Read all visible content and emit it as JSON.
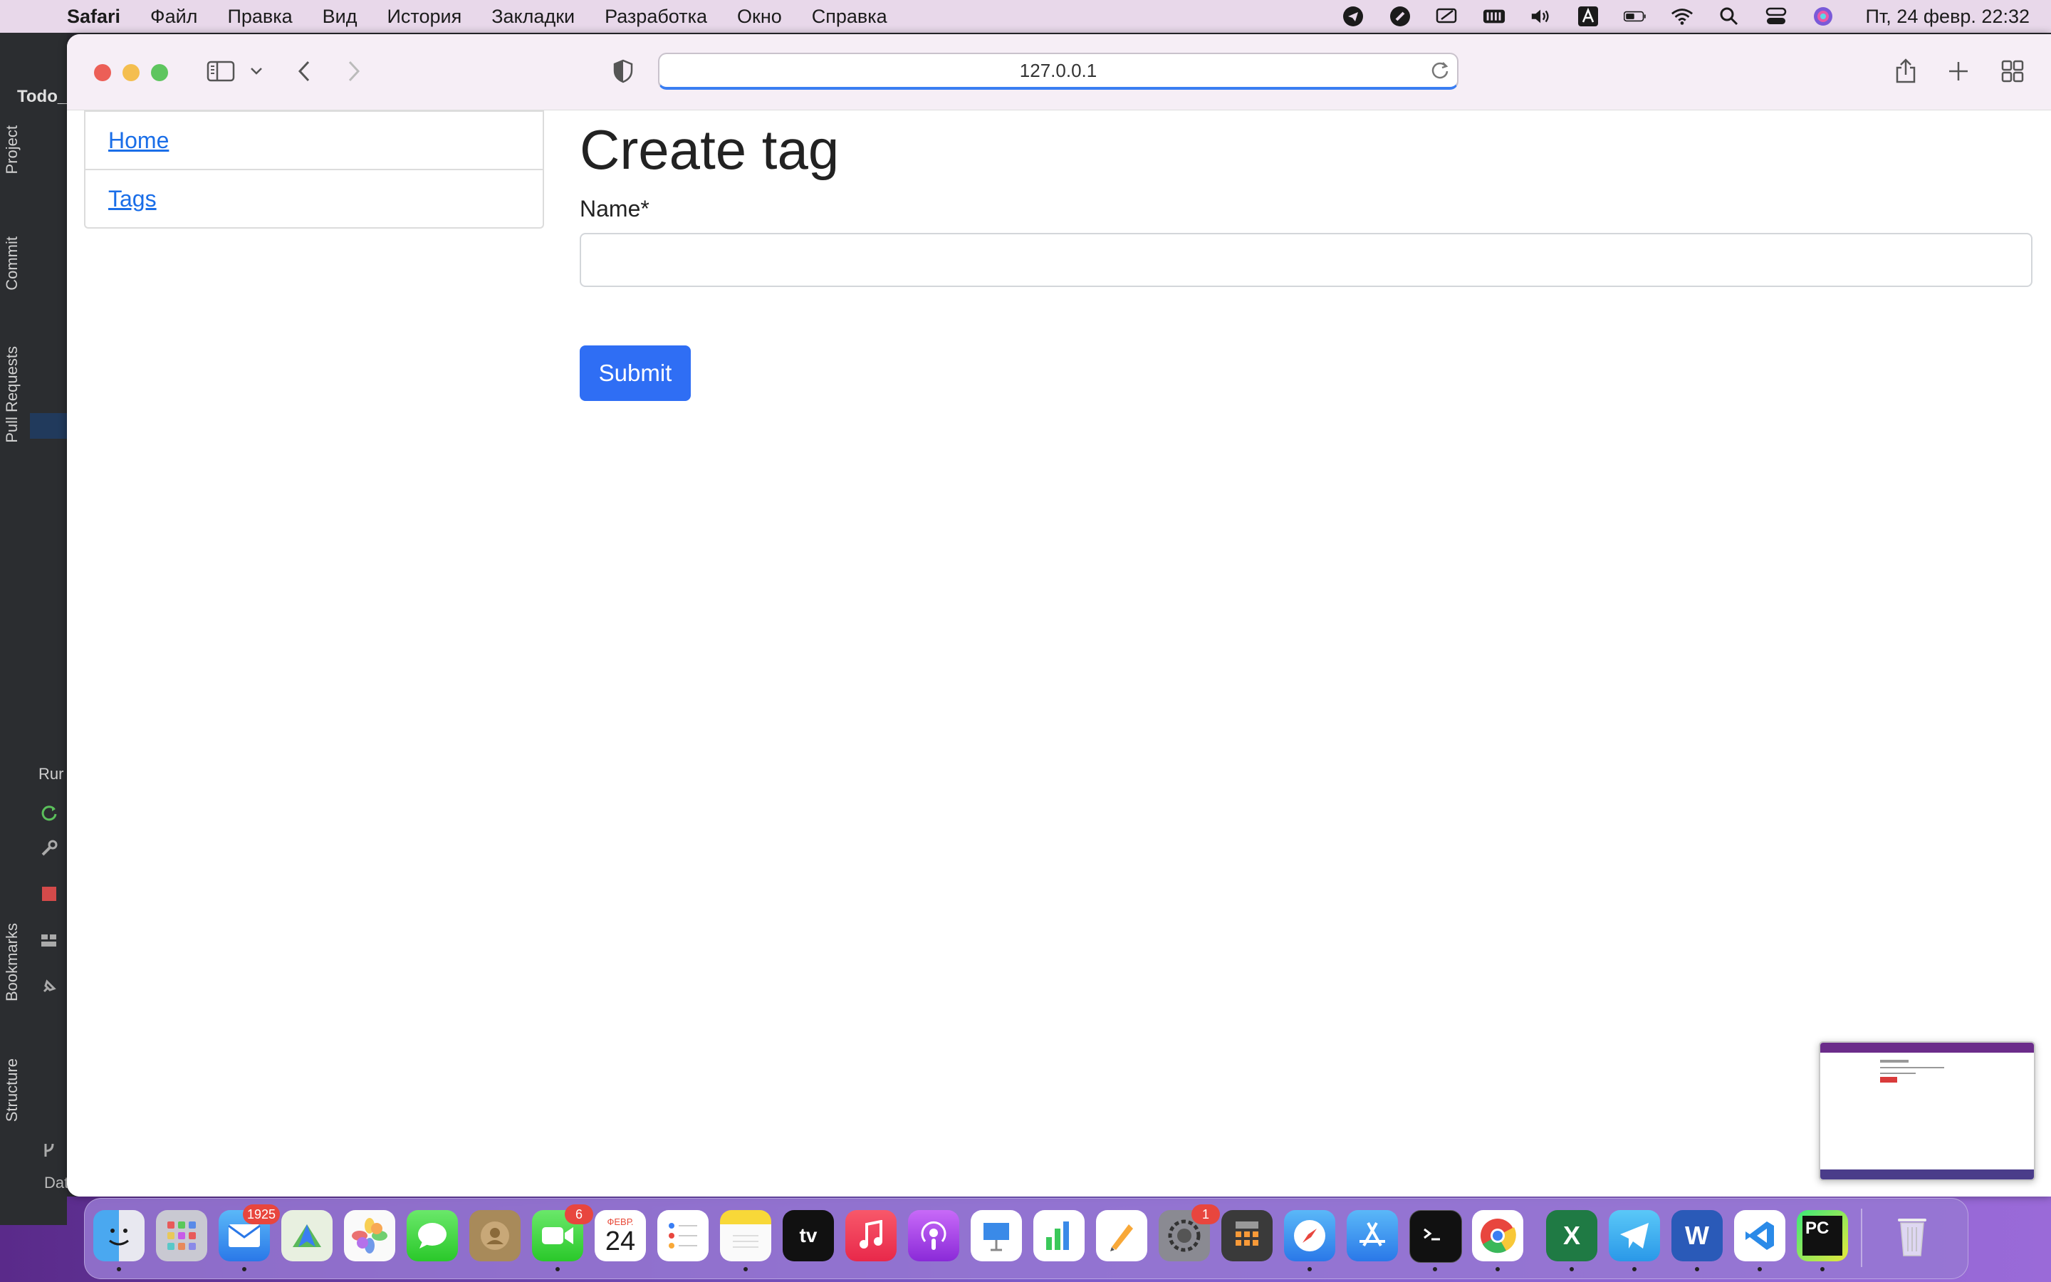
{
  "menubar": {
    "app_name": "Safari",
    "items": [
      "Файл",
      "Правка",
      "Вид",
      "История",
      "Закладки",
      "Разработка",
      "Окно",
      "Справка"
    ],
    "clock": "Пт, 24 февр.  22:32"
  },
  "ide": {
    "title": "Todo_",
    "tabs": [
      "Project",
      "Commit",
      "Pull Requests",
      "Bookmarks",
      "Structure"
    ],
    "run_label": "Rur",
    "bottom_label": "Dat"
  },
  "browser": {
    "url": "127.0.0.1"
  },
  "sidenav": {
    "items": [
      {
        "label": "Home"
      },
      {
        "label": "Tags"
      }
    ]
  },
  "form": {
    "title": "Create tag",
    "name_label": "Name*",
    "name_value": "",
    "submit_label": "Submit"
  },
  "dock": {
    "mail_badge": "1925",
    "facetime_badge": "6",
    "calendar_month": "ФЕВР.",
    "calendar_day": "24",
    "settings_badge": "1",
    "tv_label": "tv",
    "pycharm_label": "PC",
    "word_label": "W",
    "excel_label": "X"
  },
  "colors": {
    "accent": "#2f6ef4",
    "link": "#1a6ee8",
    "menubar": "#e8d8ea"
  }
}
